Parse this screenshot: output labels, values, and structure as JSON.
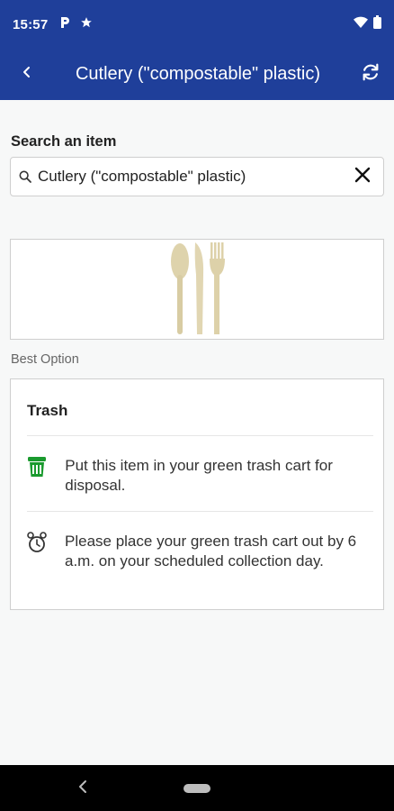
{
  "status_bar": {
    "time": "15:57",
    "left_icons": [
      "parking-icon",
      "star-icon"
    ],
    "right_icons": [
      "wifi-icon",
      "battery-icon"
    ]
  },
  "app_bar": {
    "title": "Cutlery (\"compostable\" plastic)",
    "back_icon": "back-icon",
    "refresh_icon": "refresh-icon",
    "color": "#1f3f9a"
  },
  "search": {
    "label": "Search an item",
    "value": "Cutlery (\"compostable\" plastic)",
    "placeholder": "Search an item",
    "clear_icon": "close-icon"
  },
  "item_image": {
    "icon": "cutlery-icon"
  },
  "best_option": {
    "label": "Best Option",
    "title": "Trash",
    "instructions": [
      {
        "icon": "trash-bin-icon",
        "text": "Put this item in your green trash cart for disposal."
      },
      {
        "icon": "alarm-clock-icon",
        "text": "Please place your green trash cart out by 6 a.m. on your scheduled collection day."
      }
    ],
    "accent": "#1a9a2e"
  }
}
